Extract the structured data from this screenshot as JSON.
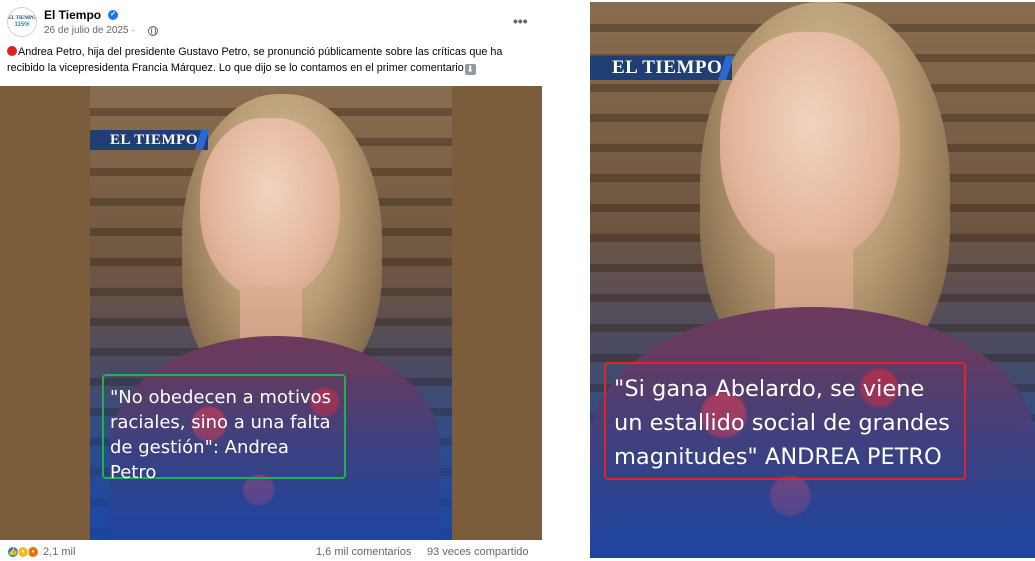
{
  "post": {
    "page_name": "El Tiempo",
    "avatar_line1": "EL TIEMPO",
    "avatar_line2": "115%",
    "date": "26 de julio de 2025 ·",
    "caption": "Andrea Petro, hija del presidente Gustavo Petro, se pronunció públicamente sobre las críticas que ha recibido la vicepresidenta Francia Márquez. Lo que dijo se lo contamos en el primer comentario",
    "image": {
      "brand": "EL TIEMPO",
      "quote": "\"No obedecen a motivos raciales, sino a una falta de gestión\": Andrea Petro",
      "box_color": "#21b04b"
    },
    "footer": {
      "reactions": "2,1 mil",
      "comments": "1,6 mil comentarios",
      "shares": "93 veces compartido"
    }
  },
  "right_image": {
    "brand": "EL TIEMPO",
    "quote": "\"Si gana Abelardo, se viene un estallido social de grandes magnitudes\" ANDREA PETRO",
    "box_color": "#e0232b"
  },
  "icons": {
    "verified": "verified-badge-icon",
    "privacy": "globe-icon",
    "more": "more-options-icon",
    "caption_prefix": "red-circle-emoji",
    "caption_suffix": "down-arrow-emoji",
    "reactions": [
      "like-icon",
      "wow-icon",
      "angry-icon"
    ]
  },
  "colors": {
    "facebook_blue": "#1877f2",
    "brand_navy": "#1e3e74",
    "frame_brown": "#7b5d3b"
  }
}
